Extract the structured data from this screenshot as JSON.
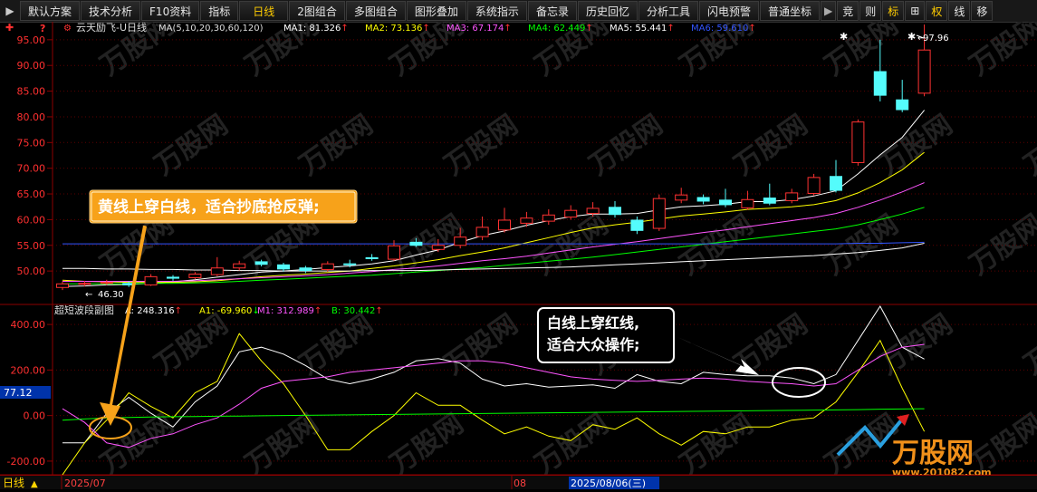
{
  "toolbar": {
    "items": [
      "默认方案",
      "技术分析",
      "F10资料",
      "指标",
      "日线",
      "2图组合",
      "多图组合",
      "图形叠加",
      "系统指示",
      "备忘录",
      "历史回忆",
      "分析工具",
      "闪电预警",
      "普通坐标"
    ],
    "right_items": [
      "竞",
      "则",
      "标",
      "⊞",
      "权",
      "线",
      "移"
    ]
  },
  "main_chart": {
    "title": "云天励飞-U日线",
    "ma_params": "MA(5,10,20,30,60,120)",
    "ma_values": [
      {
        "label": "MA1:",
        "value": "81.326",
        "color": "#ffffff"
      },
      {
        "label": "MA2:",
        "value": "73.136",
        "color": "#ffff00"
      },
      {
        "label": "MA3:",
        "value": "67.174",
        "color": "#ff55ff"
      },
      {
        "label": "MA4:",
        "value": "62.449",
        "color": "#00ff00"
      },
      {
        "label": "MA5:",
        "value": "55.441",
        "color": "#ffffff"
      },
      {
        "label": "MA6:",
        "value": "59.610",
        "color": "#3355ff"
      }
    ],
    "y_ticks": [
      "95.00",
      "90.00",
      "85.00",
      "80.00",
      "75.00",
      "70.00",
      "65.00",
      "60.00",
      "55.00",
      "50.00"
    ],
    "high_label": "97.96",
    "low_label": "46.30",
    "annotation": "黄线上穿白线，适合抄底抢反弹;"
  },
  "sub_chart": {
    "title": "超短波段副图",
    "values": [
      {
        "label": "A:",
        "value": "248.316",
        "color": "#ffffff"
      },
      {
        "label": "A1:",
        "value": "-69.960",
        "color": "#ffff00"
      },
      {
        "label": "M1:",
        "value": "312.989",
        "color": "#ff55ff"
      },
      {
        "label": "B:",
        "value": "30.442",
        "color": "#00ff00"
      }
    ],
    "y_ticks": [
      "400.00",
      "200.00",
      "0.00",
      "-200.00"
    ],
    "cursor_value": "77.12",
    "annotation_line1": "白线上穿红线,",
    "annotation_line2": "适合大众操作;"
  },
  "status_bar": {
    "period": "日线",
    "date_start": "2025/07",
    "month_mark": "08",
    "cursor_date": "2025/08/06(三)"
  },
  "watermark": {
    "brand": "万股网",
    "url": "www.201082.com"
  },
  "chart_data": {
    "type": "candlestick",
    "ylim": [
      43.5,
      98.5
    ],
    "candles": [
      {
        "o": 46.8,
        "c": 47.5,
        "h": 48.0,
        "l": 46.3
      },
      {
        "o": 47.6,
        "c": 47.6,
        "h": 48.1,
        "l": 47.0
      },
      {
        "o": 47.8,
        "c": 47.8,
        "h": 48.3,
        "l": 47.3
      },
      {
        "o": 47.6,
        "c": 47.3,
        "h": 48.0,
        "l": 46.9
      },
      {
        "o": 47.3,
        "c": 48.9,
        "h": 49.4,
        "l": 47.1
      },
      {
        "o": 48.8,
        "c": 48.6,
        "h": 49.2,
        "l": 48.1
      },
      {
        "o": 48.7,
        "c": 49.4,
        "h": 49.8,
        "l": 48.4
      },
      {
        "o": 49.3,
        "c": 50.6,
        "h": 52.7,
        "l": 49.0
      },
      {
        "o": 50.6,
        "c": 51.4,
        "h": 52.0,
        "l": 50.1
      },
      {
        "o": 51.8,
        "c": 51.3,
        "h": 52.2,
        "l": 50.9
      },
      {
        "o": 51.2,
        "c": 50.4,
        "h": 51.6,
        "l": 49.9
      },
      {
        "o": 50.6,
        "c": 50.1,
        "h": 51.0,
        "l": 49.6
      },
      {
        "o": 50.3,
        "c": 51.4,
        "h": 51.9,
        "l": 49.9
      },
      {
        "o": 51.4,
        "c": 51.3,
        "h": 52.2,
        "l": 50.7
      },
      {
        "o": 52.6,
        "c": 52.4,
        "h": 53.3,
        "l": 52.0
      },
      {
        "o": 52.3,
        "c": 54.9,
        "h": 56.0,
        "l": 52.0
      },
      {
        "o": 55.6,
        "c": 55.0,
        "h": 56.4,
        "l": 54.7
      },
      {
        "o": 54.2,
        "c": 55.0,
        "h": 56.2,
        "l": 53.7
      },
      {
        "o": 55.0,
        "c": 56.6,
        "h": 58.4,
        "l": 54.4
      },
      {
        "o": 56.7,
        "c": 58.5,
        "h": 60.6,
        "l": 56.0
      },
      {
        "o": 58.0,
        "c": 59.9,
        "h": 62.3,
        "l": 57.5
      },
      {
        "o": 59.3,
        "c": 60.3,
        "h": 61.5,
        "l": 58.6
      },
      {
        "o": 59.7,
        "c": 60.9,
        "h": 62.0,
        "l": 59.0
      },
      {
        "o": 60.5,
        "c": 61.8,
        "h": 62.8,
        "l": 60.0
      },
      {
        "o": 61.2,
        "c": 62.2,
        "h": 63.4,
        "l": 60.6
      },
      {
        "o": 62.4,
        "c": 61.0,
        "h": 63.6,
        "l": 60.4
      },
      {
        "o": 59.9,
        "c": 57.9,
        "h": 60.6,
        "l": 57.2
      },
      {
        "o": 58.3,
        "c": 64.1,
        "h": 64.9,
        "l": 57.8
      },
      {
        "o": 63.8,
        "c": 64.8,
        "h": 66.2,
        "l": 63.2
      },
      {
        "o": 64.3,
        "c": 63.6,
        "h": 64.9,
        "l": 63.0
      },
      {
        "o": 63.8,
        "c": 62.9,
        "h": 66.0,
        "l": 62.4
      },
      {
        "o": 62.3,
        "c": 63.9,
        "h": 65.6,
        "l": 61.9
      },
      {
        "o": 64.2,
        "c": 63.2,
        "h": 67.0,
        "l": 62.8
      },
      {
        "o": 63.7,
        "c": 65.2,
        "h": 66.0,
        "l": 63.2
      },
      {
        "o": 65.1,
        "c": 68.2,
        "h": 68.9,
        "l": 64.7
      },
      {
        "o": 68.4,
        "c": 65.7,
        "h": 71.6,
        "l": 65.3
      },
      {
        "o": 71.1,
        "c": 79.0,
        "h": 79.5,
        "l": 70.5
      },
      {
        "o": 88.8,
        "c": 84.2,
        "h": 95.0,
        "l": 83.0
      },
      {
        "o": 83.3,
        "c": 81.4,
        "h": 87.2,
        "l": 80.9
      },
      {
        "o": 84.6,
        "c": 93.0,
        "h": 97.96,
        "l": 84.0
      }
    ],
    "series": [
      {
        "name": "MA1",
        "color": "#ffffff",
        "values": [
          47.0,
          47.1,
          47.3,
          47.4,
          47.6,
          47.9,
          48.3,
          48.8,
          49.3,
          49.8,
          50.0,
          50.3,
          50.7,
          51.0,
          51.4,
          52.0,
          53.1,
          54.1,
          55.6,
          56.9,
          57.8,
          58.9,
          59.8,
          60.6,
          61.1,
          61.1,
          61.2,
          61.9,
          62.5,
          62.7,
          63.0,
          63.5,
          63.5,
          63.9,
          64.6,
          65.6,
          68.9,
          72.6,
          76.0,
          81.3
        ]
      },
      {
        "name": "MA2",
        "color": "#ffff00",
        "values": [
          48.2,
          48.0,
          47.9,
          47.8,
          47.8,
          47.8,
          47.9,
          48.1,
          48.5,
          48.9,
          49.2,
          49.4,
          49.7,
          50.0,
          50.5,
          51.0,
          51.6,
          52.2,
          53.0,
          53.7,
          54.5,
          55.5,
          56.5,
          57.5,
          58.4,
          59.0,
          59.5,
          60.1,
          60.7,
          61.1,
          61.5,
          62.0,
          62.2,
          62.5,
          62.9,
          63.7,
          65.2,
          67.2,
          69.7,
          73.1
        ]
      },
      {
        "name": "MA3",
        "color": "#ff55ff",
        "values": [
          48.0,
          48.0,
          48.0,
          48.0,
          48.0,
          48.0,
          48.1,
          48.3,
          48.5,
          48.7,
          48.9,
          49.1,
          49.3,
          49.6,
          49.9,
          50.3,
          50.6,
          51.0,
          51.5,
          52.0,
          52.4,
          52.9,
          53.5,
          54.1,
          54.7,
          55.2,
          55.7,
          56.3,
          56.9,
          57.5,
          58.0,
          58.6,
          59.2,
          59.8,
          60.4,
          61.2,
          62.4,
          63.8,
          65.4,
          67.2
        ]
      },
      {
        "name": "MA4",
        "color": "#00ff00",
        "values": [
          47.5,
          47.5,
          47.5,
          47.5,
          47.6,
          47.6,
          47.7,
          47.8,
          48.0,
          48.2,
          48.4,
          48.6,
          48.8,
          49.0,
          49.2,
          49.5,
          49.8,
          50.1,
          50.4,
          50.7,
          51.1,
          51.5,
          51.9,
          52.3,
          52.7,
          53.2,
          53.7,
          54.2,
          54.7,
          55.2,
          55.7,
          56.2,
          56.7,
          57.2,
          57.7,
          58.2,
          59.0,
          60.0,
          61.1,
          62.4
        ]
      },
      {
        "name": "MA5",
        "color": "#ffffff",
        "values": [
          50.5,
          50.5,
          50.4,
          50.4,
          50.3,
          50.3,
          50.2,
          50.2,
          50.1,
          50.1,
          50.0,
          50.0,
          50.0,
          50.0,
          50.1,
          50.1,
          50.1,
          50.2,
          50.3,
          50.4,
          50.5,
          50.6,
          50.7,
          50.8,
          51.0,
          51.2,
          51.4,
          51.6,
          51.8,
          52.0,
          52.2,
          52.4,
          52.6,
          52.8,
          53.0,
          53.3,
          53.6,
          54.0,
          54.5,
          55.4
        ]
      },
      {
        "name": "MA6",
        "color": "#3355ff",
        "values": [
          55.3,
          55.3,
          55.3,
          55.3,
          55.3,
          55.3,
          55.3,
          55.3,
          55.3,
          55.3,
          55.3,
          55.3,
          55.3,
          55.3,
          55.3,
          55.3,
          55.3,
          55.3,
          55.3,
          55.3,
          55.3,
          55.3,
          55.3,
          55.3,
          55.3,
          55.3,
          55.3,
          55.3,
          55.3,
          55.3,
          55.3,
          55.3,
          55.3,
          55.3,
          55.3,
          55.3,
          55.4,
          55.4,
          55.5,
          55.6
        ]
      }
    ],
    "sub_ylim": [
      -260,
      480
    ],
    "sub_series": [
      {
        "name": "A",
        "color": "#ffffff",
        "values": [
          -120,
          -120,
          10,
          80,
          10,
          -50,
          60,
          130,
          280,
          300,
          270,
          220,
          160,
          140,
          160,
          190,
          240,
          250,
          230,
          160,
          130,
          140,
          125,
          130,
          135,
          120,
          180,
          150,
          140,
          190,
          180,
          175,
          175,
          165,
          140,
          180,
          330,
          480,
          300,
          248
        ]
      },
      {
        "name": "A1",
        "color": "#ffff00",
        "values": [
          -260,
          -120,
          -20,
          100,
          40,
          -10,
          100,
          150,
          360,
          240,
          140,
          0,
          -150,
          -150,
          -70,
          0,
          100,
          45,
          45,
          -20,
          -80,
          -50,
          -90,
          -110,
          -40,
          -60,
          -10,
          -80,
          -130,
          -70,
          -80,
          -50,
          -50,
          -20,
          -10,
          60,
          190,
          330,
          120,
          -70
        ]
      },
      {
        "name": "M1",
        "color": "#ff55ff",
        "values": [
          30,
          -30,
          -120,
          -140,
          -100,
          -80,
          -40,
          -10,
          50,
          120,
          150,
          160,
          170,
          190,
          200,
          210,
          220,
          230,
          240,
          240,
          230,
          210,
          190,
          170,
          160,
          155,
          150,
          155,
          160,
          165,
          160,
          150,
          145,
          140,
          130,
          140,
          200,
          260,
          300,
          313
        ]
      },
      {
        "name": "B",
        "color": "#00ff00",
        "values": [
          -20,
          -15,
          -10,
          -8,
          -6,
          -5,
          -4,
          -3,
          -2,
          -1,
          0,
          1,
          2,
          3,
          4,
          5,
          6,
          7,
          8,
          9,
          10,
          11,
          12,
          13,
          14,
          15,
          16,
          17,
          18,
          19,
          20,
          21,
          22,
          23,
          24,
          25,
          26,
          28,
          29,
          30
        ]
      }
    ]
  }
}
